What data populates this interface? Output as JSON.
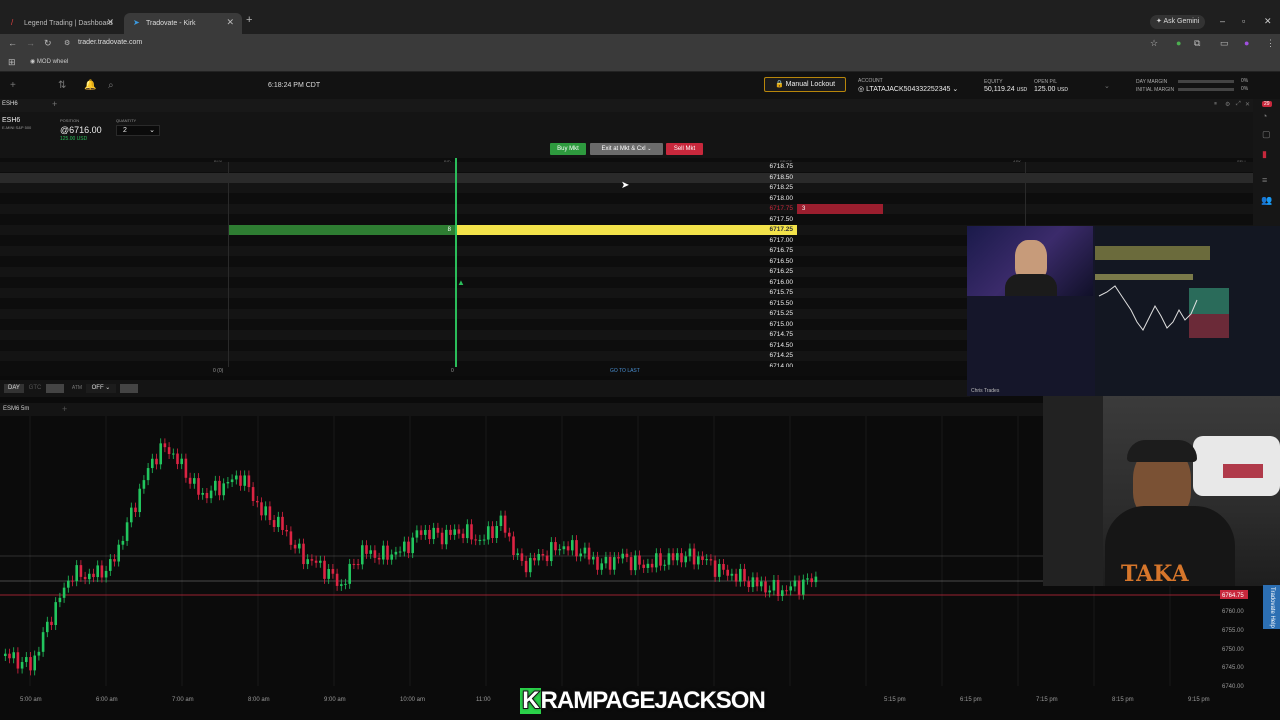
{
  "browser": {
    "tabs": [
      {
        "label": "Legend Trading | Dashboard"
      },
      {
        "label": "Tradovate - Kirk"
      }
    ],
    "ask_gemini": "Ask Gemini",
    "url": "trader.tradovate.com",
    "bookmark": "MOD wheel"
  },
  "app": {
    "clock": "6:18:24 PM CDT",
    "manual_lockout": "Manual Lockout",
    "account_label": "ACCOUNT",
    "account": "LTATAJACK504332252345",
    "equity_label": "EQUITY",
    "equity": "50,119.24",
    "equity_ccy": "USD",
    "open_pl_label": "OPEN P/L",
    "open_pl": "125.00",
    "open_pl_ccy": "USD",
    "day_margin_label": "DAY MARGIN",
    "day_margin": "0%",
    "initial_margin_label": "INITIAL MARGIN",
    "initial_margin": "0%"
  },
  "dom": {
    "tab": "ESH6",
    "symbol": "ESH6",
    "symbol_desc": "E-MINI S&P 500",
    "position_label": "POSITION",
    "position": "@6716.00",
    "position_pl": "125.00 USD",
    "quantity_label": "QUANTITY",
    "quantity": "2",
    "buy_mkt": "Buy Mkt",
    "exit_mkt": "Exit at Mkt & Cxl",
    "sell_mkt": "Sell Mkt",
    "col_buy": "BUY",
    "col_bid": "BID",
    "col_price": "PRICE",
    "col_ask": "ASK",
    "col_sell": "SELL",
    "prices": [
      "6718.75",
      "6718.50",
      "6718.25",
      "6718.00",
      "6717.75",
      "6717.50",
      "6717.25",
      "6717.00",
      "6716.75",
      "6716.50",
      "6716.25",
      "6716.00",
      "6715.75",
      "6715.50",
      "6715.25",
      "6715.00",
      "6714.75",
      "6714.50",
      "6714.25",
      "6714.00"
    ],
    "ask_size": "3",
    "bid_size": "8",
    "foot_buy": "0 (0)",
    "foot_bid": "0",
    "go_to_last": "GO TO LAST",
    "ctrl_day": "DAY",
    "ctrl_gtc": "GTC",
    "ctrl_atm": "ATM",
    "ctrl_off": "OFF"
  },
  "chart": {
    "symbol": "ESM6 5m",
    "price_tag": "6764.75",
    "y_ticks": [
      "6760.00",
      "6755.00",
      "6750.00",
      "6745.00",
      "6740.00"
    ],
    "x_ticks": [
      "5:00 am",
      "6:00 am",
      "7:00 am",
      "8:00 am",
      "9:00 am",
      "10:00 am",
      "11:00",
      "5:15 pm",
      "6:15 pm",
      "7:15 pm",
      "8:15 pm",
      "9:15 pm"
    ],
    "stream_label": "Chris Trades"
  },
  "help_tab": "Tradovate Help",
  "watermark_k": "K",
  "watermark_rest": "RAMPAGEJACKSON",
  "colors": {
    "up": "#22c55e",
    "down": "#dc2443",
    "accent": "#2c6fb3"
  }
}
